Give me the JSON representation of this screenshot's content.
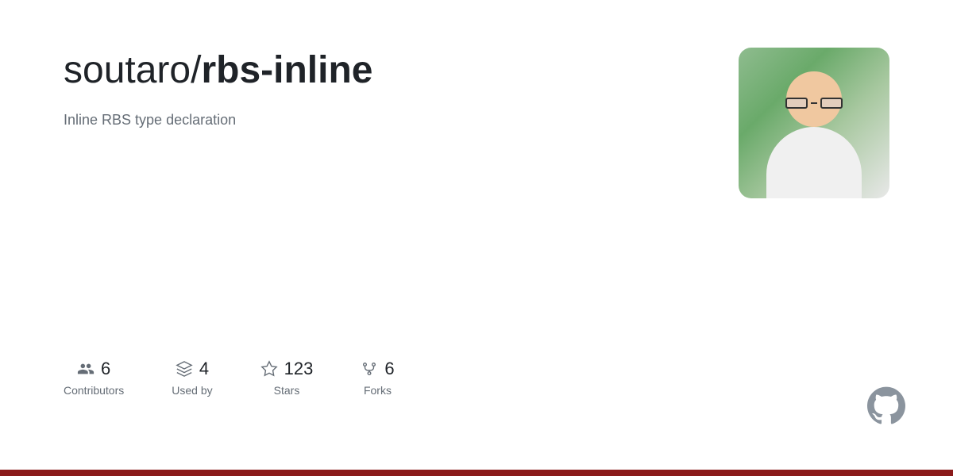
{
  "repo": {
    "owner": "soutaro",
    "separator": "/",
    "name": "rbs-inline",
    "description": "Inline RBS type declaration"
  },
  "stats": [
    {
      "id": "contributors",
      "count": "6",
      "label": "Contributors",
      "icon": "people-icon"
    },
    {
      "id": "used-by",
      "count": "4",
      "label": "Used by",
      "icon": "package-icon"
    },
    {
      "id": "stars",
      "count": "123",
      "label": "Stars",
      "icon": "star-icon"
    },
    {
      "id": "forks",
      "count": "6",
      "label": "Forks",
      "icon": "fork-icon"
    }
  ],
  "bottom_bar_color": "#8b1a1a",
  "github_icon_label": "GitHub"
}
